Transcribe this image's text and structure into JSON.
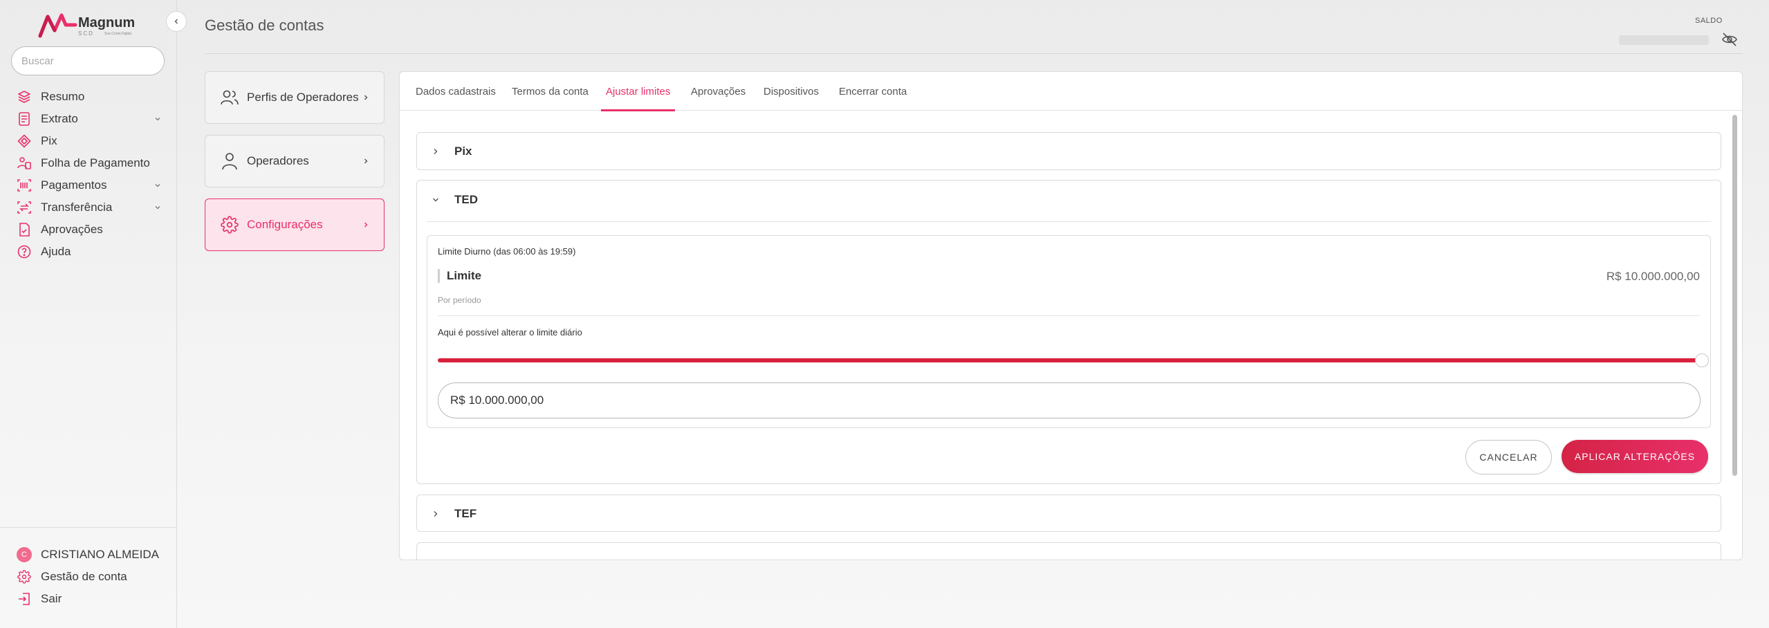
{
  "brand": {
    "name": "Magnum",
    "tagline": "SCD",
    "subtag": "Sua Conta Digital",
    "accent": "#e8306a"
  },
  "sidebar": {
    "search_placeholder": "Buscar",
    "items": [
      {
        "label": "Resumo",
        "icon": "layers-icon",
        "has_chevron": false
      },
      {
        "label": "Extrato",
        "icon": "document-list-icon",
        "has_chevron": true
      },
      {
        "label": "Pix",
        "icon": "pix-icon",
        "has_chevron": false
      },
      {
        "label": "Folha de Pagamento",
        "icon": "payroll-icon",
        "has_chevron": false
      },
      {
        "label": "Pagamentos",
        "icon": "barcode-icon",
        "has_chevron": true
      },
      {
        "label": "Transferência",
        "icon": "transfer-icon",
        "has_chevron": true
      },
      {
        "label": "Aprovações",
        "icon": "approval-doc-icon",
        "has_chevron": false
      },
      {
        "label": "Ajuda",
        "icon": "help-circle-icon",
        "has_chevron": false
      }
    ],
    "user": {
      "initial": "C",
      "name": "CRISTIANO ALMEIDA"
    },
    "account_label": "Gestão de conta",
    "logout_label": "Sair"
  },
  "header": {
    "title": "Gestão de contas",
    "saldo_label": "SALDO"
  },
  "menu": [
    {
      "label": "Perfis de Operadores",
      "icon": "users-icon",
      "active": false
    },
    {
      "label": "Operadores",
      "icon": "user-icon",
      "active": false
    },
    {
      "label": "Configurações",
      "icon": "gear-icon",
      "active": true
    }
  ],
  "tabs": [
    {
      "label": "Dados cadastrais",
      "active": false
    },
    {
      "label": "Termos da conta",
      "active": false
    },
    {
      "label": "Ajustar limites",
      "active": true
    },
    {
      "label": "Aprovações",
      "active": false
    },
    {
      "label": "Dispositivos",
      "active": false
    },
    {
      "label": "Encerrar conta",
      "active": false
    }
  ],
  "sections": {
    "pix": {
      "title": "Pix",
      "expanded": false
    },
    "ted": {
      "title": "TED",
      "expanded": true,
      "period_title": "Limite Diurno (das 06:00 às 19:59)",
      "limit_label": "Limite",
      "limit_value": "R$ 10.000.000,00",
      "per_period": "Por período",
      "alter_text": "Aqui é possível alterar o limite diário",
      "slider_fraction": 1.0,
      "input_value": "R$ 10.000.000,00",
      "cancel_label": "CANCELAR",
      "apply_label": "APLICAR ALTERAÇÕES"
    },
    "tef": {
      "title": "TEF",
      "expanded": false
    }
  }
}
